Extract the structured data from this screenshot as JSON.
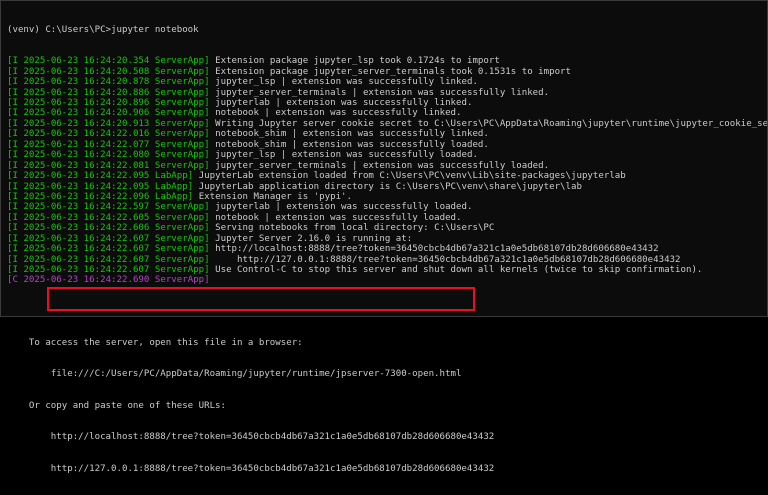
{
  "window": {
    "prompt": "(venv) C:\\Users\\PC>jupyter notebook"
  },
  "log_lines": [
    {
      "level": "I",
      "ts": "2025-06-23 16:24:20.354",
      "app": "ServerApp",
      "msg": "Extension package jupyter_lsp took 0.1724s to import"
    },
    {
      "level": "I",
      "ts": "2025-06-23 16:24:20.508",
      "app": "ServerApp",
      "msg": "Extension package jupyter_server_terminals took 0.1531s to import"
    },
    {
      "level": "I",
      "ts": "2025-06-23 16:24:20.878",
      "app": "ServerApp",
      "msg": "jupyter_lsp | extension was successfully linked."
    },
    {
      "level": "I",
      "ts": "2025-06-23 16:24:20.886",
      "app": "ServerApp",
      "msg": "jupyter_server_terminals | extension was successfully linked."
    },
    {
      "level": "I",
      "ts": "2025-06-23 16:24:20.896",
      "app": "ServerApp",
      "msg": "jupyterlab | extension was successfully linked."
    },
    {
      "level": "I",
      "ts": "2025-06-23 16:24:20.906",
      "app": "ServerApp",
      "msg": "notebook | extension was successfully linked."
    },
    {
      "level": "I",
      "ts": "2025-06-23 16:24:20.913",
      "app": "ServerApp",
      "msg": "Writing Jupyter server cookie secret to C:\\Users\\PC\\AppData\\Roaming\\jupyter\\runtime\\jupyter_cookie_secret"
    },
    {
      "level": "I",
      "ts": "2025-06-23 16:24:22.016",
      "app": "ServerApp",
      "msg": "notebook_shim | extension was successfully linked."
    },
    {
      "level": "I",
      "ts": "2025-06-23 16:24:22.077",
      "app": "ServerApp",
      "msg": "notebook_shim | extension was successfully loaded."
    },
    {
      "level": "I",
      "ts": "2025-06-23 16:24:22.080",
      "app": "ServerApp",
      "msg": "jupyter_lsp | extension was successfully loaded."
    },
    {
      "level": "I",
      "ts": "2025-06-23 16:24:22.081",
      "app": "ServerApp",
      "msg": "jupyter_server_terminals | extension was successfully loaded."
    },
    {
      "level": "I",
      "ts": "2025-06-23 16:24:22.095",
      "app": "LabApp",
      "msg": "JupyterLab extension loaded from C:\\Users\\PC\\venv\\Lib\\site-packages\\jupyterlab"
    },
    {
      "level": "I",
      "ts": "2025-06-23 16:24:22.095",
      "app": "LabApp",
      "msg": "JupyterLab application directory is C:\\Users\\PC\\venv\\share\\jupyter\\lab"
    },
    {
      "level": "I",
      "ts": "2025-06-23 16:24:22.096",
      "app": "LabApp",
      "msg": "Extension Manager is 'pypi'."
    },
    {
      "level": "I",
      "ts": "2025-06-23 16:24:22.597",
      "app": "ServerApp",
      "msg": "jupyterlab | extension was successfully loaded."
    },
    {
      "level": "I",
      "ts": "2025-06-23 16:24:22.605",
      "app": "ServerApp",
      "msg": "notebook | extension was successfully loaded."
    },
    {
      "level": "I",
      "ts": "2025-06-23 16:24:22.606",
      "app": "ServerApp",
      "msg": "Serving notebooks from local directory: C:\\Users\\PC"
    },
    {
      "level": "I",
      "ts": "2025-06-23 16:24:22.607",
      "app": "ServerApp",
      "msg": "Jupyter Server 2.16.0 is running at:"
    },
    {
      "level": "I",
      "ts": "2025-06-23 16:24:22.607",
      "app": "ServerApp",
      "msg": "http://localhost:8888/tree?token=36450cbcb4db67a321c1a0e5db68107db28d606680e43432"
    },
    {
      "level": "I",
      "ts": "2025-06-23 16:24:22.607",
      "app": "ServerApp",
      "msg": "    http://127.0.0.1:8888/tree?token=36450cbcb4db67a321c1a0e5db68107db28d606680e43432"
    },
    {
      "level": "I",
      "ts": "2025-06-23 16:24:22.607",
      "app": "ServerApp",
      "msg": "Use Control-C to stop this server and shut down all kernels (twice to skip confirmation)."
    },
    {
      "level": "C",
      "ts": "2025-06-23 16:24:22.690",
      "app": "ServerApp",
      "msg": ""
    }
  ],
  "footer": {
    "access_line": "    To access the server, open this file in a browser:",
    "file_url": "        file:///C:/Users/PC/AppData/Roaming/jupyter/runtime/jpserver-7300-open.html",
    "or_copy": "    Or copy and paste one of these URLs:",
    "url_1": "        http://localhost:8888/tree?token=36450cbcb4db67a321c1a0e5db68107db28d606680e43432",
    "url_2": "        http://127.0.0.1:8888/tree?token=36450cbcb4db67a321c1a0e5db68107db28d606680e43432"
  },
  "colors": {
    "background": "#0c0c0c",
    "text": "#cccccc",
    "info": "#16c60c",
    "critical": "#b148c6",
    "highlight_box": "#e81123"
  }
}
